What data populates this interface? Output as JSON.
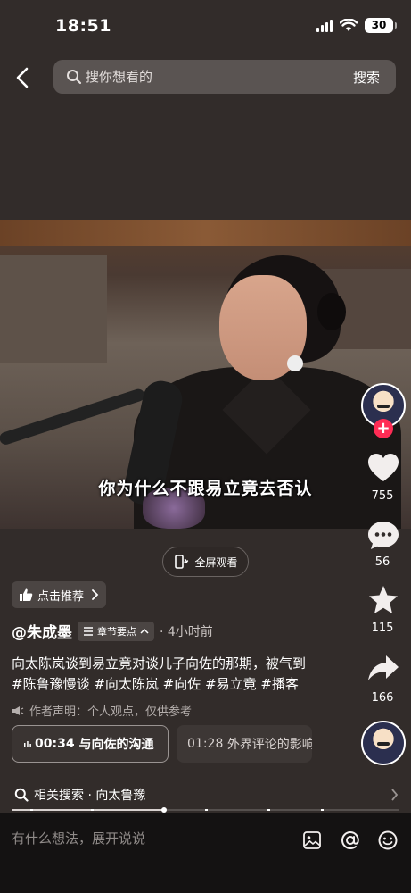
{
  "status_bar": {
    "time": "18:51",
    "battery": "30"
  },
  "search": {
    "placeholder": "搜你想看的",
    "button_label": "搜索"
  },
  "video": {
    "subtitle": "你为什么不跟易立竟去否认",
    "fullscreen_label": "全屏观看"
  },
  "side_rail": {
    "likes": "755",
    "comments": "56",
    "favorites": "115",
    "shares": "166"
  },
  "recommend_label": "点击推荐",
  "post": {
    "author": "@朱成墨",
    "chapter_tag": "章节要点",
    "time_ago": "· 4小时前",
    "description": "向太陈岚谈到易立竟对谈儿子向佐的那期，被气到",
    "hashtags": "#陈鲁豫慢谈 #向太陈岚 #向佐 #易立竟 #播客",
    "disclaimer": "作者声明：个人观点，仅供参考"
  },
  "chapters": [
    {
      "time": "00:34",
      "title": "与向佐的沟通"
    },
    {
      "time": "01:28",
      "title": "外界评论的影响"
    }
  ],
  "related_search": "相关搜索 · 向太鲁豫",
  "comment_placeholder": "有什么想法，展开说说",
  "colors": {
    "follow_accent": "#ff2c55",
    "background": "#322c2a"
  },
  "icons": [
    "back-icon",
    "search-icon",
    "heart-icon",
    "comment-icon",
    "star-icon",
    "share-icon",
    "image-icon",
    "at-icon",
    "emoji-icon",
    "thumbs-up-icon",
    "speaker-icon",
    "rotate-screen-icon",
    "chapter-list-icon"
  ]
}
